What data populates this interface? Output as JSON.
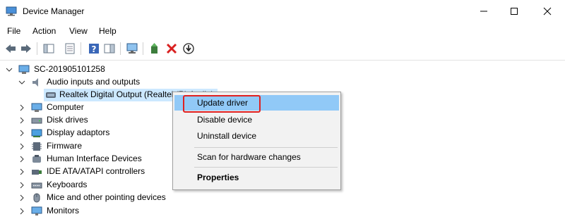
{
  "window": {
    "title": "Device Manager"
  },
  "menu": {
    "file": "File",
    "action": "Action",
    "view": "View",
    "help": "Help"
  },
  "toolbar": {
    "icons": [
      "back-arrow-icon",
      "forward-arrow-icon",
      "show-hide-console-tree-icon",
      "properties-icon",
      "help-icon",
      "action-pane-icon",
      "scan-hardware-icon",
      "update-driver-icon",
      "uninstall-device-icon",
      "download-icon"
    ]
  },
  "tree": {
    "root": "SC-201905101258",
    "audio_category": "Audio inputs and outputs",
    "audio_device": "Realtek Digital Output (Realtek(R) Audio)",
    "categories": [
      "Computer",
      "Disk drives",
      "Display adaptors",
      "Firmware",
      "Human Interface Devices",
      "IDE ATA/ATAPI controllers",
      "Keyboards",
      "Mice and other pointing devices",
      "Monitors"
    ]
  },
  "context_menu": {
    "update_driver": "Update driver",
    "disable_device": "Disable device",
    "uninstall_device": "Uninstall device",
    "scan_hardware": "Scan for hardware changes",
    "properties": "Properties"
  },
  "colors": {
    "highlight": "#91c9f7",
    "selection": "#cce8ff",
    "annotation": "#e02020"
  }
}
